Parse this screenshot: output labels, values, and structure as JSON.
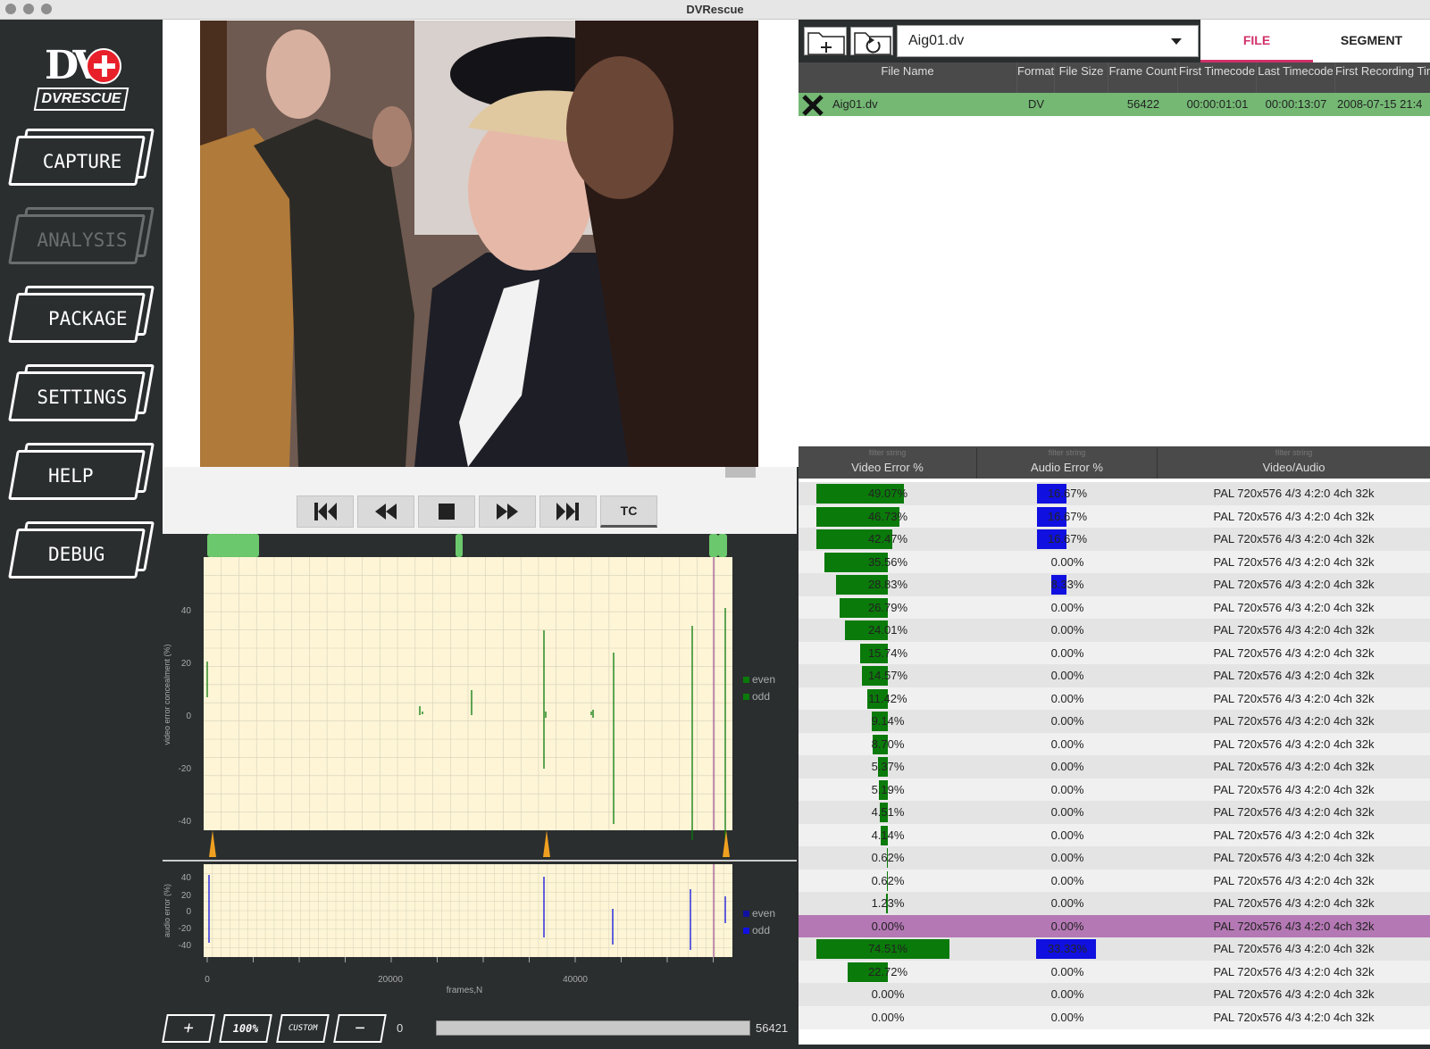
{
  "window": {
    "title": "DVRescue"
  },
  "sidebar": {
    "logo_text": "DVRESCUE",
    "items": [
      {
        "label": "CAPTURE"
      },
      {
        "label": "ANALYSIS"
      },
      {
        "label": "PACKAGE"
      },
      {
        "label": "SETTINGS"
      },
      {
        "label": "HELP"
      },
      {
        "label": "DEBUG"
      }
    ]
  },
  "player": {
    "tc_label": "TC"
  },
  "toolbar": {
    "selected_file": "Aig01.dv",
    "tab_file": "FILE",
    "tab_segment": "SEGMENT"
  },
  "files_table": {
    "headers": [
      "File Name",
      "Format",
      "File Size",
      "Frame Count",
      "First Timecode",
      "Last Timecode",
      "First Recording Time"
    ],
    "row": {
      "name": "Aig01.dv",
      "format": "DV",
      "size": "",
      "frame_count": "56422",
      "first_tc": "00:00:01:01",
      "last_tc": "00:00:13:07",
      "first_rec": "2008-07-15 21:4"
    }
  },
  "segments_table": {
    "filter_placeholder": "filter string",
    "headers": {
      "video": "Video Error %",
      "audio": "Audio Error %",
      "va": "Video/Audio"
    },
    "rows": [
      {
        "v": "49.07%",
        "vf": 0.4907,
        "a": "16.67%",
        "af": 0.1667,
        "va": "PAL 720x576 4/3 4:2:0 4ch 32k"
      },
      {
        "v": "46.73%",
        "vf": 0.4673,
        "a": "16.67%",
        "af": 0.1667,
        "va": "PAL 720x576 4/3 4:2:0 4ch 32k"
      },
      {
        "v": "42.47%",
        "vf": 0.4247,
        "a": "16.67%",
        "af": 0.1667,
        "va": "PAL 720x576 4/3 4:2:0 4ch 32k"
      },
      {
        "v": "35.56%",
        "vf": 0.3556,
        "a": "0.00%",
        "af": 0,
        "va": "PAL 720x576 4/3 4:2:0 4ch 32k"
      },
      {
        "v": "28.83%",
        "vf": 0.2883,
        "a": "8.33%",
        "af": 0.0833,
        "va": "PAL 720x576 4/3 4:2:0 4ch 32k"
      },
      {
        "v": "26.79%",
        "vf": 0.2679,
        "a": "0.00%",
        "af": 0,
        "va": "PAL 720x576 4/3 4:2:0 4ch 32k"
      },
      {
        "v": "24.01%",
        "vf": 0.2401,
        "a": "0.00%",
        "af": 0,
        "va": "PAL 720x576 4/3 4:2:0 4ch 32k"
      },
      {
        "v": "15.74%",
        "vf": 0.1574,
        "a": "0.00%",
        "af": 0,
        "va": "PAL 720x576 4/3 4:2:0 4ch 32k"
      },
      {
        "v": "14.57%",
        "vf": 0.1457,
        "a": "0.00%",
        "af": 0,
        "va": "PAL 720x576 4/3 4:2:0 4ch 32k"
      },
      {
        "v": "11.42%",
        "vf": 0.1142,
        "a": "0.00%",
        "af": 0,
        "va": "PAL 720x576 4/3 4:2:0 4ch 32k"
      },
      {
        "v": "9.14%",
        "vf": 0.0914,
        "a": "0.00%",
        "af": 0,
        "va": "PAL 720x576 4/3 4:2:0 4ch 32k"
      },
      {
        "v": "8.70%",
        "vf": 0.087,
        "a": "0.00%",
        "af": 0,
        "va": "PAL 720x576 4/3 4:2:0 4ch 32k"
      },
      {
        "v": "5.37%",
        "vf": 0.0537,
        "a": "0.00%",
        "af": 0,
        "va": "PAL 720x576 4/3 4:2:0 4ch 32k"
      },
      {
        "v": "5.19%",
        "vf": 0.0519,
        "a": "0.00%",
        "af": 0,
        "va": "PAL 720x576 4/3 4:2:0 4ch 32k"
      },
      {
        "v": "4.51%",
        "vf": 0.0451,
        "a": "0.00%",
        "af": 0,
        "va": "PAL 720x576 4/3 4:2:0 4ch 32k"
      },
      {
        "v": "4.14%",
        "vf": 0.0414,
        "a": "0.00%",
        "af": 0,
        "va": "PAL 720x576 4/3 4:2:0 4ch 32k"
      },
      {
        "v": "0.62%",
        "vf": 0.0062,
        "a": "0.00%",
        "af": 0,
        "va": "PAL 720x576 4/3 4:2:0 4ch 32k"
      },
      {
        "v": "0.62%",
        "vf": 0.0062,
        "a": "0.00%",
        "af": 0,
        "va": "PAL 720x576 4/3 4:2:0 4ch 32k"
      },
      {
        "v": "1.23%",
        "vf": 0.0123,
        "a": "0.00%",
        "af": 0,
        "va": "PAL 720x576 4/3 4:2:0 4ch 32k"
      },
      {
        "v": "0.00%",
        "vf": 0,
        "a": "0.00%",
        "af": 0,
        "va": "PAL 720x576 4/3 4:2:0 4ch 32k",
        "selected": true
      },
      {
        "v": "74.51%",
        "vf": 0.7451,
        "a": "33.33%",
        "af": 0.3333,
        "va": "PAL 720x576 4/3 4:2:0 4ch 32k"
      },
      {
        "v": "22.72%",
        "vf": 0.2272,
        "a": "0.00%",
        "af": 0,
        "va": "PAL 720x576 4/3 4:2:0 4ch 32k"
      },
      {
        "v": "0.00%",
        "vf": 0,
        "a": "0.00%",
        "af": 0,
        "va": "PAL 720x576 4/3 4:2:0 4ch 32k"
      },
      {
        "v": "0.00%",
        "vf": 0,
        "a": "0.00%",
        "af": 0,
        "va": "PAL 720x576 4/3 4:2:0 4ch 32k"
      }
    ]
  },
  "graph": {
    "video_ylabel": "video error concealment (%)",
    "audio_ylabel": "audio error (%)",
    "xlabel": "frames,N",
    "video_yticks": [
      "40",
      "20",
      "0",
      "-20",
      "-40"
    ],
    "audio_yticks": [
      "40",
      "20",
      "0",
      "-20",
      "-40"
    ],
    "xticks": [
      "0",
      "20000",
      "40000"
    ],
    "legend_even": "even",
    "legend_odd": "odd",
    "range_start": "0",
    "range_end": "56421",
    "zoom_in": "+",
    "zoom_100": "100%",
    "zoom_custom": "CUSTOM",
    "zoom_out": "−",
    "colors": {
      "video": "#0a7a0a",
      "audio": "#1010e0",
      "bg": "#fdf5d6",
      "selected_row": "#b478b4"
    }
  }
}
